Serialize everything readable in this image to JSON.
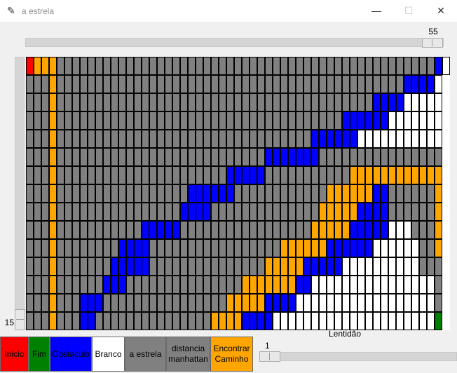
{
  "window": {
    "title": "a estrela",
    "icon": "feather-icon",
    "controls": {
      "minimize": "—",
      "maximize": "☐",
      "close": "✕"
    }
  },
  "grid_size_scale": {
    "value": "55",
    "fraction": 1.0
  },
  "vertical_scale": {
    "value": "15",
    "fraction": 1.0
  },
  "speed": {
    "label": "Lentidão",
    "value": "1",
    "fraction": 0.0
  },
  "buttons": [
    {
      "label": "Inicio",
      "bg": "#ff0000",
      "fg": "#000000"
    },
    {
      "label": "Fim",
      "bg": "#008000",
      "fg": "#000000"
    },
    {
      "label": "Obstaculo",
      "bg": "#0000ff",
      "fg": "#000000"
    },
    {
      "label": "Branco",
      "bg": "#ffffff",
      "fg": "#000000"
    },
    {
      "label": "a estrela",
      "bg": "#808080",
      "fg": "#000000"
    },
    {
      "label": "distancia\nmanhattan",
      "bg": "#808080",
      "fg": "#000000"
    },
    {
      "label": "Encontrar\nCaminho",
      "bg": "#ffa500",
      "fg": "#000000"
    }
  ],
  "grid": {
    "cols": 55,
    "rows": 15,
    "palette": {
      "G": "#808080",
      "B": "#0000ff",
      "W": "#ffffff",
      "O": "#ffa500",
      "R": "#ff0000",
      "E": "#008000"
    },
    "cells": [
      "ROOOGGGGGGGGGGGGGGGGGGGGGGGGGGGGGGGGGGGGGGGGGGGGGGGGGBW",
      "GGGOGGGGGGGGGGGGGGGGGGGGGGGGGGGGGGGGGGGGGGGGGGGGGBBBBW",
      "GGGOGGGGGGGGGGGGGGGGGGGGGGGGGGGGGGGGGGGGGGGGGBBBBWWWWW",
      "GGGOGGGGGGGGGGGGGGGGGGGGGGGGGGGGGGGGGGGGGBBBBBBWWWWWWW",
      "GGGOGGGGGGGGGGGGGGGGGGGGGGGGGGGGGGGGGBBBBBBWWWWWWWWWWW",
      "GGGOGGGGGGGGGGGGGGGGGGGGGGGGGGGBBBBBBBGGGGGGGGGGGGGGGG",
      "GGGOGGGGGGGGGGGGGGGGGGGGGGBBBBBGGGGGGGGGGGOOOOOOOOOOOO",
      "GGGOGGGGGGGGGGGGGGGGGBBBBBBGGGGGGGGGGGGOOOOOOBBGGGGGGO",
      "GGGOGGGGGGGGGGGGGGGGBBBBGGGGGGGGGGGGGGOOOOOBBBBGGGGGGO",
      "GGGOGGGGGGGGGGGBBBBBGGGGGGGGGGGGGGGGGOOOOOBBBBBWWWGGGO",
      "GGGOGGGGGGGGBBBBGGGGGGGGGGGGGGGGGOOOOOOBBBBBBWWWWWWGGO",
      "GGGOGGGGGGGBBBBBGGGGGGGGGGGGGGGOOOOOBBBBBWWWWWWWWWWGGG",
      "GGGOGGGGGGBBBGGGGGGGGGGGGGGGOOOOOOOBBWWWWWWWWWWWWWWWWG",
      "GGGOGGGBBBGGGGGGGGGGGGGGGGOOOOOBBBBWWWWWWWWWWWWWWWWWWG",
      "GGGOGGGBBGGGGGGGGGGGGGGGOOOOBBBBWWWWWWWWWWWWWWWWWWWWWE"
    ]
  }
}
